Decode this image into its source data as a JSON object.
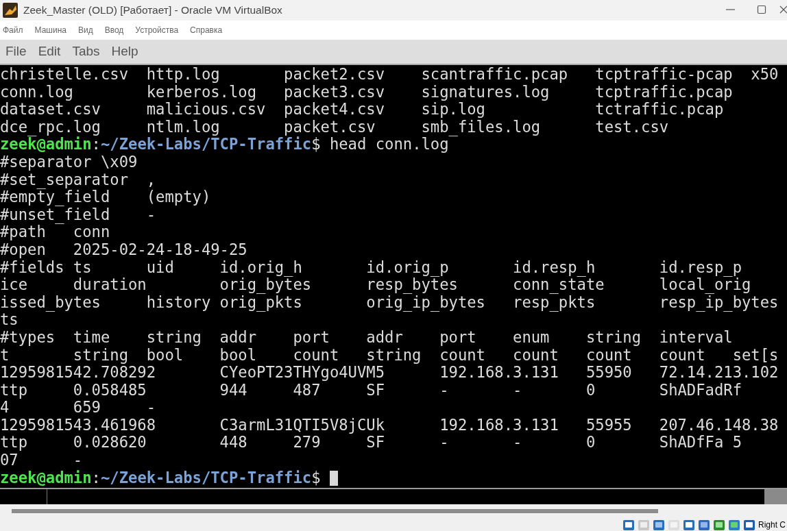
{
  "window": {
    "title": "Zeek_Master (OLD) [Работает] - Oracle VM VirtualBox"
  },
  "vm_menu": [
    "Файл",
    "Машина",
    "Вид",
    "Ввод",
    "Устройства",
    "Справка"
  ],
  "terminal_menu": [
    "File",
    "Edit",
    "Tabs",
    "Help"
  ],
  "terminal_lines": [
    {
      "kind": "output",
      "text": "christelle.csv  http.log       packet2.csv    scantraffic.pcap   tcptraffic-pcap  x50"
    },
    {
      "kind": "output",
      "text": "conn.log        kerberos.log   packet3.csv    signatures.log     tcptraffic.pcap"
    },
    {
      "kind": "output",
      "text": "dataset.csv     malicious.csv  packet4.csv    sip.log            tctraffic.pcap"
    },
    {
      "kind": "output",
      "text": "dce_rpc.log     ntlm.log       packet.csv     smb_files.log      test.csv"
    },
    {
      "kind": "prompt",
      "user": "zeek@admin",
      "separator": ":",
      "path": "~/Zeek-Labs/TCP-Traffic",
      "symbol": "$",
      "command": "head conn.log",
      "cursor": false
    },
    {
      "kind": "output",
      "text": "#separator \\x09"
    },
    {
      "kind": "output",
      "text": "#set_separator  ,"
    },
    {
      "kind": "output",
      "text": "#empty_field    (empty)"
    },
    {
      "kind": "output",
      "text": "#unset_field    -"
    },
    {
      "kind": "output",
      "text": "#path   conn"
    },
    {
      "kind": "output",
      "text": "#open   2025-02-24-18-49-25"
    },
    {
      "kind": "output",
      "text": "#fields ts      uid     id.orig_h       id.orig_p       id.resp_h       id.resp_p"
    },
    {
      "kind": "output",
      "text": "ice     duration        orig_bytes      resp_bytes      conn_state      local_orig"
    },
    {
      "kind": "output",
      "text": "issed_bytes     history orig_pkts       orig_ip_bytes   resp_pkts       resp_ip_bytes"
    },
    {
      "kind": "output",
      "text": "ts"
    },
    {
      "kind": "output",
      "text": "#types  time    string  addr    port    addr    port    enum    string  interval"
    },
    {
      "kind": "output",
      "text": "t       string  bool    bool    count   string  count   count   count   count   set[s"
    },
    {
      "kind": "output",
      "text": "1295981542.708292       CYeoPT23THYgo4UVM5      192.168.3.131   55950   72.14.213.102"
    },
    {
      "kind": "output",
      "text": "ttp     0.058485        944     487     SF      -       -       0       ShADFadRf"
    },
    {
      "kind": "output",
      "text": "4       659     -"
    },
    {
      "kind": "output",
      "text": "1295981543.461968       C3armL31QTI5V8jCUk      192.168.3.131   55955   207.46.148.38"
    },
    {
      "kind": "output",
      "text": "ttp     0.028620        448     279     SF      -       -       0       ShADfFa 5"
    },
    {
      "kind": "output",
      "text": "07      -"
    },
    {
      "kind": "prompt",
      "user": "zeek@admin",
      "separator": ":",
      "path": "~/Zeek-Labs/TCP-Traffic",
      "symbol": "$",
      "cursor": true
    }
  ],
  "status_bar": {
    "host_key": "Right C"
  }
}
